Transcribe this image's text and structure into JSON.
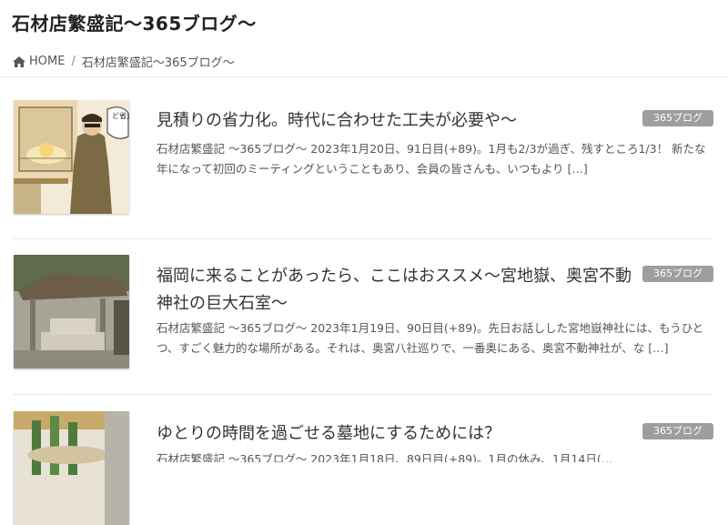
{
  "header": {
    "title": "石材店繁盛記～365ブログ～"
  },
  "breadcrumb": {
    "home_label": "HOME",
    "separator": "/",
    "current": "石材店繁盛記～365ブログ～"
  },
  "posts": [
    {
      "title": "見積りの省力化。時代に合わせた工夫が必要や～",
      "category": "365ブログ",
      "excerpt": "石材店繁盛記 ～365ブログ～ 2023年1月20日、91日目(+89)。1月も2/3が過ぎ、残すところ1/3！ 新たな年になって初回のミーティングということもあり、会員の皆さんも、いつもより […]",
      "thumb_caption": "ど省力で"
    },
    {
      "title": "福岡に来ることがあったら、ここはおススメ～宮地嶽、奥宮不動神社の巨大石室～",
      "category": "365ブログ",
      "excerpt": "石材店繁盛記 ～365ブログ～ 2023年1月19日、90日目(+89)。先日お話しした宮地嶽神社には、もうひとつ、すごく魅力的な場所がある。それは、奥宮八社巡りで、一番奥にある、奥宮不動神社が、な […]"
    },
    {
      "title": "ゆとりの時間を過ごせる墓地にするためには？",
      "category": "365ブログ",
      "excerpt": "石材店繁盛記 ～365ブログ～ 2023年1月18日、89日目(+89)。1月の休み、1月14日(…"
    }
  ]
}
